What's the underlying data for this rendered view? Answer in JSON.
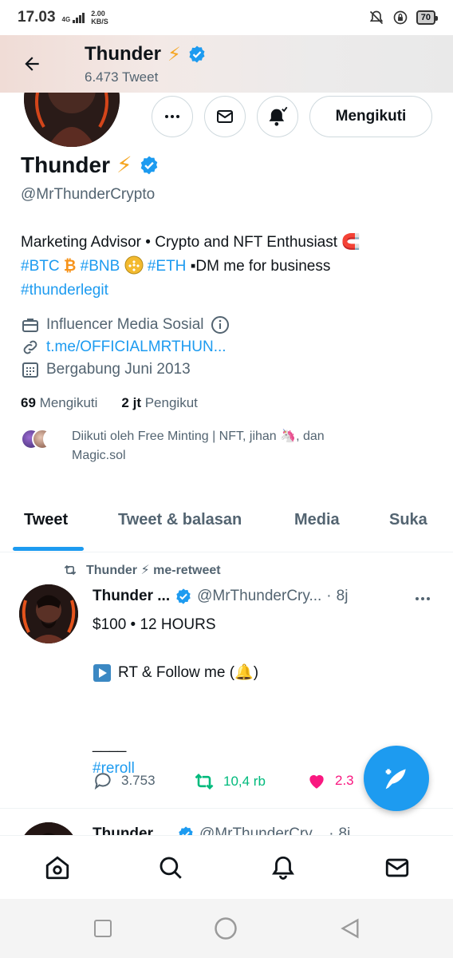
{
  "status_bar": {
    "time": "17.03",
    "network": "4G",
    "speed_top": "2.00",
    "speed_unit": "KB/S",
    "battery": "70"
  },
  "header": {
    "name": "Thunder",
    "emoji": "⚡",
    "tweet_count": "6.473 Tweet"
  },
  "actions": {
    "follow_label": "Mengikuti"
  },
  "profile": {
    "name": "Thunder",
    "emoji": "⚡",
    "handle": "@MrThunderCrypto",
    "bio_line1": "Marketing Advisor • Crypto and NFT Enthusiast",
    "bio_line1_emoji": "🧲",
    "tag_btc": "#BTC",
    "btc_emoji": "₿",
    "tag_bnb": "#BNB",
    "tag_eth": "#ETH",
    "bio_dm": "▪DM me for business",
    "tag_thunderlegit": "#thunderlegit",
    "category": "Influencer Media Sosial",
    "website": "t.me/OFFICIALMRTHUN...",
    "joined": "Bergabung Juni 2013",
    "following_count": "69",
    "following_label": "Mengikuti",
    "followers_count": "2 jt",
    "followers_label": "Pengikut",
    "followed_by_line1": "Diikuti oleh Free Minting | NFT, jihan 🦄, dan",
    "followed_by_line2": "Magic.sol"
  },
  "tabs": [
    {
      "label": "Tweet",
      "active": true
    },
    {
      "label": "Tweet & balasan",
      "active": false
    },
    {
      "label": "Media",
      "active": false
    },
    {
      "label": "Suka",
      "active": false
    }
  ],
  "tweet": {
    "retweet_by": "Thunder ⚡ me-retweet",
    "name": "Thunder ...",
    "handle": "@MrThunderCry...",
    "time": "8j",
    "body_line1": "$100 • 12 HOURS",
    "body_line2": "RT & Follow me (🔔)",
    "body_line3": "____",
    "body_tag": "#reroll",
    "replies": "3.753",
    "retweets": "10,4 rb",
    "likes": "2.3"
  },
  "tweet2": {
    "name": "Thunder",
    "handle": "@MrThunderCry...",
    "time": "8j"
  },
  "colors": {
    "accent": "#1d9bf0",
    "text_primary": "#0f1419",
    "text_secondary": "#536471",
    "retweet_green": "#00ba7c",
    "like_pink": "#f91880",
    "verified": "#1d9bf0"
  }
}
